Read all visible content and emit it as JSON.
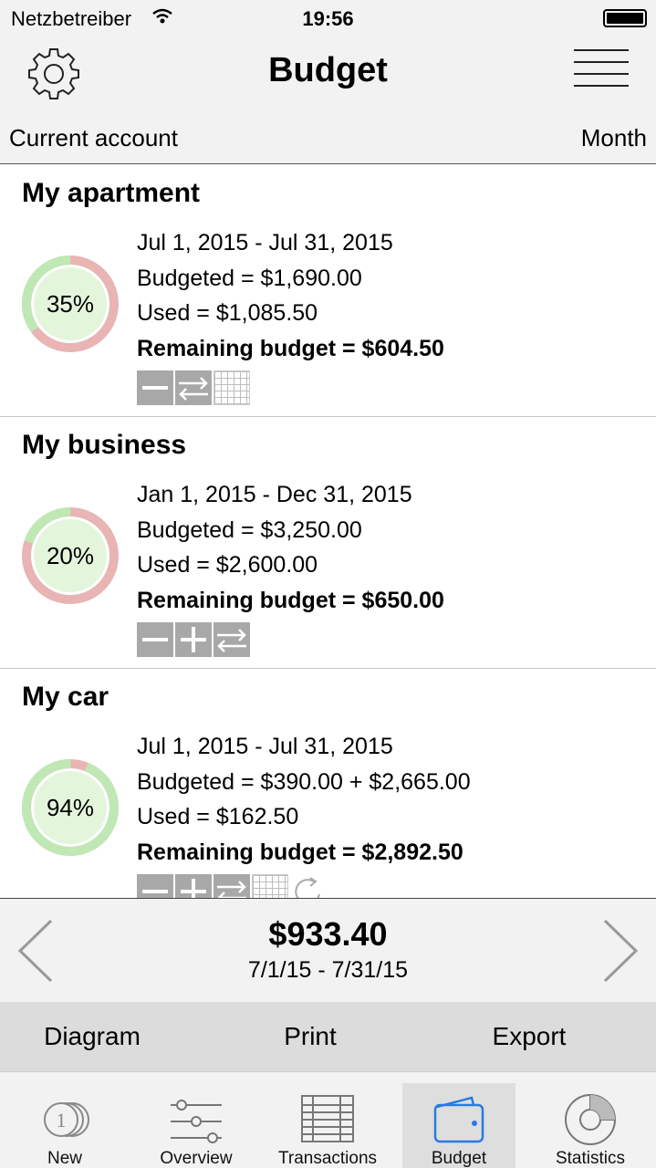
{
  "status_bar": {
    "carrier": "Netzbetreiber",
    "time": "19:56"
  },
  "nav": {
    "title": "Budget",
    "account": "Current account",
    "period": "Month"
  },
  "budgets": [
    {
      "name": "My apartment",
      "percent_label": "35%",
      "percent": 35,
      "date_range": "Jul 1, 2015 - Jul 31, 2015",
      "budgeted": "Budgeted = $1,690.00",
      "used": "Used = $1,085.50",
      "remaining": "Remaining budget = $604.50",
      "actions": [
        "minus",
        "transfer",
        "grid"
      ]
    },
    {
      "name": "My business",
      "percent_label": "20%",
      "percent": 20,
      "date_range": "Jan 1, 2015 - Dec 31, 2015",
      "budgeted": "Budgeted = $3,250.00",
      "used": "Used = $2,600.00",
      "remaining": "Remaining budget = $650.00",
      "actions": [
        "minus",
        "plus",
        "transfer"
      ]
    },
    {
      "name": "My car",
      "percent_label": "94%",
      "percent": 94,
      "date_range": "Jul 1, 2015 - Jul 31, 2015",
      "budgeted": "Budgeted = $390.00 + $2,665.00",
      "used": "Used = $162.50",
      "remaining": "Remaining budget = $2,892.50",
      "actions": [
        "minus",
        "plus",
        "transfer",
        "grid",
        "refresh"
      ]
    }
  ],
  "summary": {
    "total": "$933.40",
    "range": "7/1/15 - 7/31/15"
  },
  "action_bar": {
    "diagram": "Diagram",
    "print": "Print",
    "export": "Export"
  },
  "tabs": [
    {
      "label": "New",
      "icon": "coins-icon"
    },
    {
      "label": "Overview",
      "icon": "sliders-icon"
    },
    {
      "label": "Transactions",
      "icon": "table-icon"
    },
    {
      "label": "Budget",
      "icon": "wallet-icon",
      "active": true
    },
    {
      "label": "Statistics",
      "icon": "pie-chart-icon"
    }
  ],
  "colors": {
    "remaining_green": "#bfe8b4",
    "used_red": "#e8b4b4",
    "donut_fill": "#e3f6dc",
    "active_blue": "#2a7ae2"
  }
}
